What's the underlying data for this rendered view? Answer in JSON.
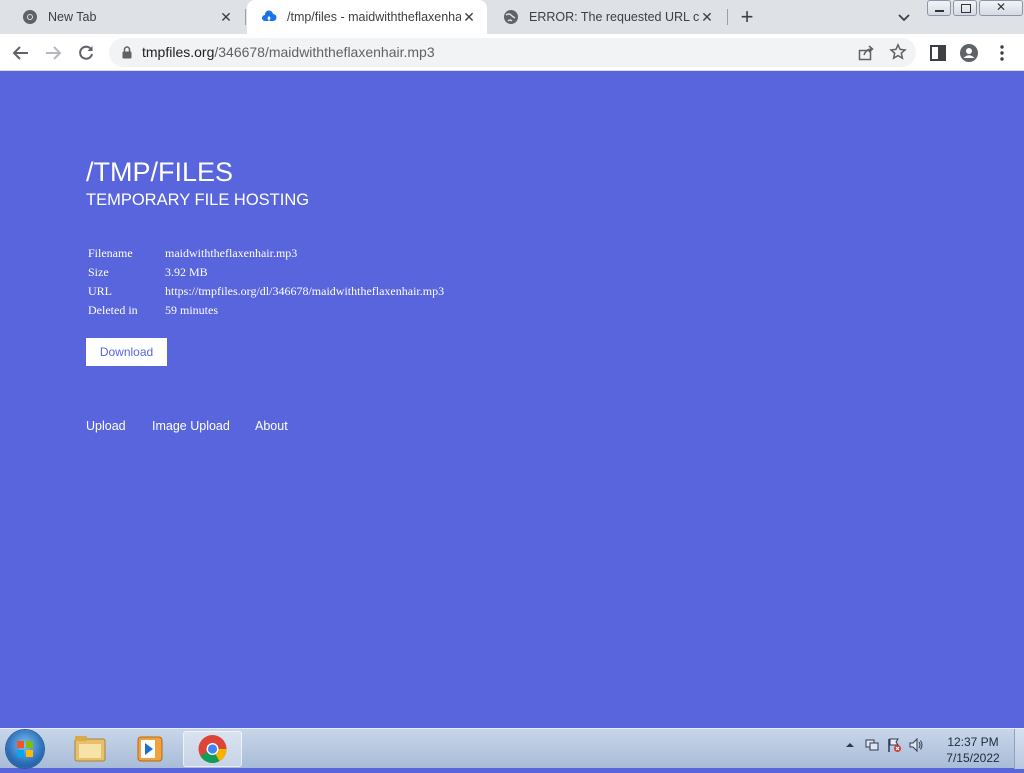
{
  "browser": {
    "tabs": [
      {
        "title": "New Tab",
        "icon": "chrome-icon"
      },
      {
        "title": "/tmp/files - maidwiththeflaxenha",
        "icon": "cloud-upload-icon",
        "active": true
      },
      {
        "title": "ERROR: The requested URL could",
        "icon": "globe-icon"
      }
    ],
    "address": {
      "host": "tmpfiles.org",
      "path": "/346678/maidwiththeflaxenhair.mp3"
    }
  },
  "page": {
    "title": "/TMP/FILES",
    "subtitle": "TEMPORARY FILE HOSTING",
    "file_info": [
      {
        "label": "Filename",
        "value": "maidwiththeflaxenhair.mp3"
      },
      {
        "label": "Size",
        "value": "3.92 MB"
      },
      {
        "label": "URL",
        "value": "https://tmpfiles.org/dl/346678/maidwiththeflaxenhair.mp3"
      },
      {
        "label": "Deleted in",
        "value": "59 minutes"
      }
    ],
    "download_label": "Download",
    "footer_links": [
      "Upload",
      "Image Upload",
      "About"
    ],
    "colors": {
      "background": "#5865dd",
      "text": "#ffffff"
    }
  },
  "taskbar": {
    "time": "12:37 PM",
    "date": "7/15/2022"
  }
}
